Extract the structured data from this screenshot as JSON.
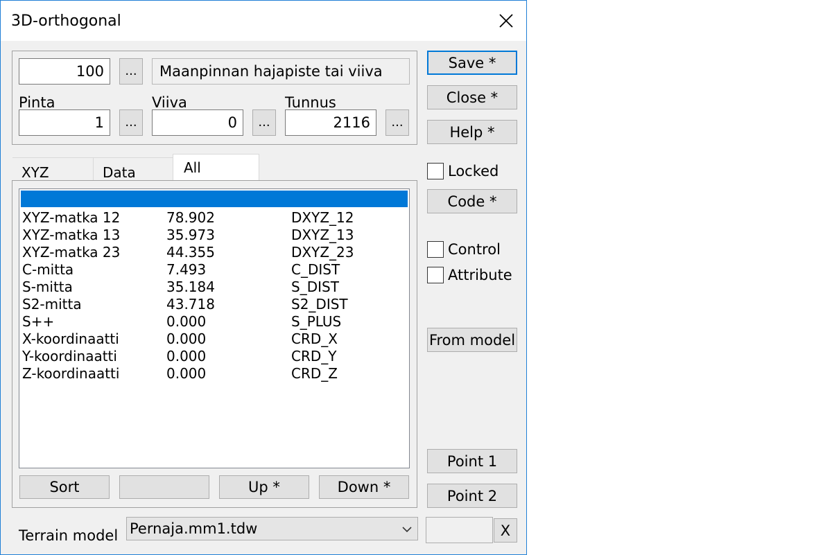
{
  "window": {
    "title": "3D-orthogonal"
  },
  "header": {
    "code_value": "100",
    "code_browse": "...",
    "code_description": "Maanpinnan hajapiste tai viiva",
    "pinta_label": "Pinta",
    "pinta_value": "1",
    "pinta_browse": "...",
    "viiva_label": "Viiva",
    "viiva_value": "0",
    "viiva_browse": "...",
    "tunnus_label": "Tunnus",
    "tunnus_value": "2116",
    "tunnus_browse": "..."
  },
  "tabs": [
    {
      "label": "XYZ",
      "active": false
    },
    {
      "label": "Data",
      "active": false
    },
    {
      "label": "All",
      "active": true
    }
  ],
  "list": {
    "rows": [
      {
        "name": "XYZ-matka 12",
        "value": "78.902",
        "code": "DXYZ_12"
      },
      {
        "name": "XYZ-matka 13",
        "value": "35.973",
        "code": "DXYZ_13"
      },
      {
        "name": "XYZ-matka 23",
        "value": "44.355",
        "code": "DXYZ_23"
      },
      {
        "name": "C-mitta",
        "value": "7.493",
        "code": "C_DIST"
      },
      {
        "name": "S-mitta",
        "value": "35.184",
        "code": "S_DIST"
      },
      {
        "name": "S2-mitta",
        "value": "43.718",
        "code": "S2_DIST"
      },
      {
        "name": "S++",
        "value": "0.000",
        "code": "S_PLUS"
      },
      {
        "name": "X-koordinaatti",
        "value": "0.000",
        "code": "CRD_X"
      },
      {
        "name": "Y-koordinaatti",
        "value": "0.000",
        "code": "CRD_Y"
      },
      {
        "name": "Z-koordinaatti",
        "value": "0.000",
        "code": "CRD_Z"
      }
    ]
  },
  "list_buttons": {
    "sort": "Sort",
    "blank": "",
    "up": "Up *",
    "down": "Down *"
  },
  "side_buttons": {
    "save": "Save *",
    "close": "Close *",
    "help": "Help *",
    "locked": "Locked",
    "code": "Code *",
    "control": "Control",
    "attribute": "Attribute",
    "from_model": "From model",
    "point1": "Point 1",
    "point2": "Point 2",
    "x": "X"
  },
  "terrain": {
    "label": "Terrain model",
    "value": "Pernaja.mm1.tdw",
    "extra_value": ""
  },
  "colors": {
    "selection": "#0078d7",
    "dialog_bg": "#f0f0f0",
    "window_border": "#1f7fd6"
  }
}
